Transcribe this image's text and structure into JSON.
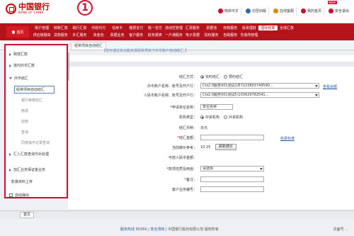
{
  "header": {
    "logo_cn": "中国银行",
    "logo_en": "BANK OF CHINA",
    "marker": "1",
    "links": [
      {
        "label": "简体中文",
        "color": "#c8102e"
      },
      {
        "label": "切至旧版",
        "color": "#2b6cb0"
      },
      {
        "label": "在线客服",
        "color": "#e38a00"
      },
      {
        "label": "我的首页",
        "color": "#c8102e"
      },
      {
        "label": "安全退出",
        "color": "#c8102e"
      }
    ],
    "new_badge": "NEW"
  },
  "nav": {
    "home": "首页",
    "row1": [
      "账户管理",
      "转账汇款",
      "跨行汇款",
      "代收代付",
      "信用卡",
      "缴费支付",
      "我一支付",
      "流动性管理",
      "汇票服务",
      "票据池",
      "存款服务",
      "投资理财",
      "国际结算",
      "全球汇款"
    ],
    "row2": [
      "供应链融资",
      "贷款服务",
      "外汇服务",
      "资金池",
      "票据业务",
      "客户服务",
      "财务报表",
      "一户通服务",
      "电子票据",
      "授权服务",
      "自助服务",
      "交易所管理"
    ],
    "active": "国际结算"
  },
  "tab": {
    "label": "经常项目自动结汇"
  },
  "notice": "【您可通过本功能实现经常项目下外币账户自动结汇。】",
  "popup": {
    "items": [
      {
        "label": "跨境汇款",
        "expanded": false
      },
      {
        "label": "境内外币汇款",
        "expanded": false
      },
      {
        "label": "外币结汇",
        "expanded": true
      }
    ],
    "subitems": [
      "经常项目自动结汇",
      "银行审核结汇",
      "修改",
      "授权",
      "查询",
      "同意操作记录查询"
    ],
    "active_sub": "经常项目自动结汇",
    "lower_items": [
      "汇入汇款查询与补处理",
      "加汇业务保证金业务",
      "影像资料上传"
    ],
    "checkbox_label": "自动弹出"
  },
  "form": {
    "title": "",
    "settlement_mode_label": "结汇方式：",
    "settlement_mode_options": [
      "实时结汇",
      "预约结汇"
    ],
    "account_label": "外币账户名称、账号及开户行：",
    "account_value": "Cts2.0服务001测试1/67223803749590...",
    "account_link": "查看余额",
    "rmb_account_label": "人民币账户名称、账号及开户行：",
    "rmb_account_value": "Cts2.0服务001测试5/103629782541...",
    "applicant_label": "申请单位名称：",
    "applicant_value": "单位名称",
    "org_type_label": "机构类型：",
    "org_type_options": [
      "中资机构",
      "外资机构"
    ],
    "currency_label": "结汇币种：",
    "currency_value": "日元",
    "amount_label": "结汇金额：",
    "amount_link": "收费标准",
    "rate_label": "当前牌价参考：",
    "rate_value": "10.25",
    "rate_button": "刷新牌价",
    "rmb_amount_label": "可结人民币金额：",
    "nature_label": "款项性质及用途：",
    "nature_value": "请选择",
    "remark_label": "备注：",
    "reference_label": "客户业务编号："
  },
  "bottom": {
    "tab": "首页"
  },
  "footer": {
    "hotline_label": "服务热线",
    "hotline": "95566",
    "security": "安全须知",
    "copyright": "中国银行股份有限公司  版权所有",
    "right": "页面号 ..."
  }
}
